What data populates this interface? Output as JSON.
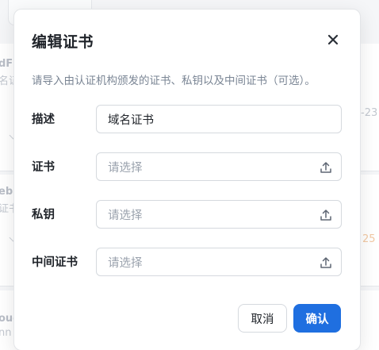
{
  "background": {
    "fragments": {
      "f1": "dFI",
      "f2": "名证",
      "f3": "-23",
      "f4": "ebu",
      "f5": "证书",
      "f6": "25",
      "f7": "oug",
      "f8": "nn"
    }
  },
  "modal": {
    "title": "编辑证书",
    "description": "请导入由认证机构颁发的证书、私钥以及中间证书（可选）。",
    "fields": [
      {
        "label": "描述",
        "value": "域名证书",
        "placeholder": ""
      },
      {
        "label": "证书",
        "value": "",
        "placeholder": "请选择"
      },
      {
        "label": "私钥",
        "value": "",
        "placeholder": "请选择"
      },
      {
        "label": "中间证书",
        "value": "",
        "placeholder": "请选择"
      }
    ],
    "buttons": {
      "cancel": "取消",
      "confirm": "确认"
    },
    "icons": {
      "close": "close-icon",
      "upload": "upload-icon"
    }
  },
  "colors": {
    "primary": "#1f6fe0",
    "text": "#1f2329",
    "muted": "#7a8594",
    "placeholder": "#9aa2ad",
    "border": "#d5d9de"
  }
}
